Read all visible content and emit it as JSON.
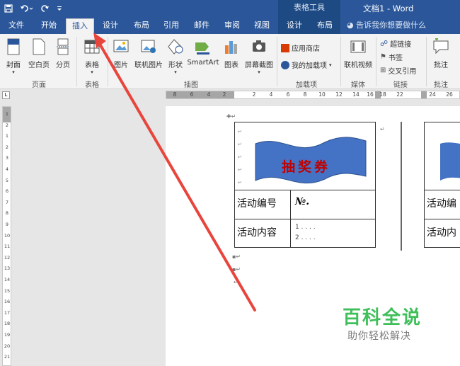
{
  "title_bar": {
    "qat_icons": [
      "save-icon",
      "undo-icon",
      "redo-icon",
      "customize-icon"
    ],
    "contextual_header": "表格工具",
    "document_title": "文档1 - Word"
  },
  "tabs": {
    "file": "文件",
    "home": "开始",
    "insert": "插入",
    "design": "设计",
    "layout": "布局",
    "references": "引用",
    "mailings": "邮件",
    "review": "审阅",
    "view": "视图",
    "table_design": "设计",
    "table_layout": "布局",
    "tell_me": "告诉我你想要做什么"
  },
  "ribbon": {
    "pages": {
      "cover": "封面",
      "blank": "空白页",
      "break": "分页",
      "group": "页面"
    },
    "tables": {
      "table": "表格",
      "group": "表格"
    },
    "illustrations": {
      "pictures": "图片",
      "online_pictures": "联机图片",
      "shapes": "形状",
      "smartart": "SmartArt",
      "chart": "图表",
      "screenshot": "屏幕截图",
      "group": "插图"
    },
    "addins": {
      "store": "应用商店",
      "my_addins": "我的加载项",
      "group": "加载项"
    },
    "media": {
      "online_video": "联机视频",
      "group": "媒体"
    },
    "links": {
      "hyperlink": "超链接",
      "bookmark": "书签",
      "cross_ref": "交叉引用",
      "group": "链接"
    },
    "comments": {
      "comment": "批注",
      "group": "批注"
    }
  },
  "ruler": {
    "corner": "L",
    "h_ticks": [
      "8",
      "6",
      "4",
      "2",
      "2",
      "4",
      "6",
      "8",
      "10",
      "12",
      "14",
      "16",
      "18",
      "22",
      "24",
      "26"
    ],
    "v_ticks": [
      "1",
      "2",
      "1",
      "2",
      "3",
      "4",
      "5",
      "6",
      "7",
      "8",
      "9",
      "10",
      "11",
      "12",
      "13",
      "14",
      "15",
      "16",
      "17",
      "18",
      "19",
      "20",
      "21"
    ]
  },
  "document": {
    "card_banner_text": "抽奖券",
    "row1_label": "活动编号",
    "row1_value": "№.",
    "row2_label": "活动内容",
    "row2_line1": "1 . . . .",
    "row2_line2": "2 . . . .",
    "card2_row1_label": "活动编",
    "card2_row2_label": "活动内"
  },
  "watermark": {
    "title": "百科全说",
    "subtitle": "助你轻松解决"
  },
  "colors": {
    "word_blue": "#2b579a",
    "banner_blue": "#4472c4",
    "banner_text": "#c00000",
    "arrow_red": "#e8453c",
    "watermark_green": "#3fbf5a"
  }
}
